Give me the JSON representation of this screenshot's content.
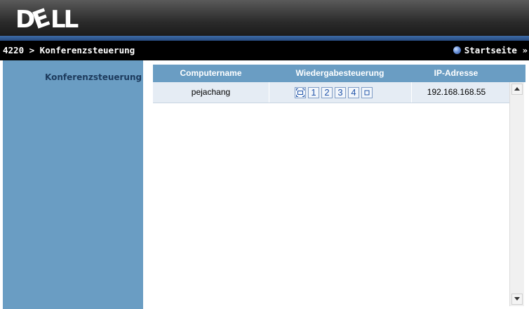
{
  "brand": {
    "logo_text": "DELL"
  },
  "nav": {
    "breadcrumb": "4220 > Konferenzsteuerung",
    "home_link": "Startseite »"
  },
  "sidebar": {
    "items": [
      {
        "label": "Konferenzsteuerung"
      }
    ]
  },
  "table": {
    "columns": [
      "Computername",
      "Wiedergabesteuerung",
      "IP-Adresse"
    ],
    "rows": [
      {
        "computer_name": "pejachang",
        "ip_address": "192.168.168.55",
        "controls": [
          {
            "label": "",
            "icon": "fullscreen-icon"
          },
          {
            "label": "1"
          },
          {
            "label": "2"
          },
          {
            "label": "3"
          },
          {
            "label": "4"
          },
          {
            "label": "",
            "icon": "stop-icon"
          }
        ]
      }
    ]
  },
  "colors": {
    "header_dark": "#161616",
    "header_blue": "#274c80",
    "sidebar": "#6a9dc3",
    "row_bg": "#e5ecf4",
    "link_blue": "#2255aa"
  }
}
